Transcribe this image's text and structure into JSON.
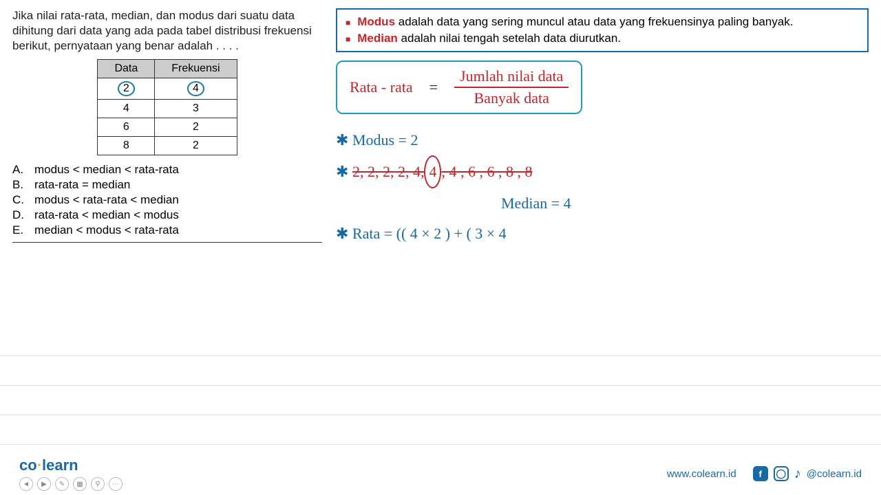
{
  "question": "Jika nilai rata-rata, median, dan modus dari suatu data dihitung dari data yang ada pada tabel distribusi frekuensi berikut, pernyataan yang benar adalah . . . .",
  "table": {
    "headers": [
      "Data",
      "Frekuensi"
    ],
    "rows": [
      {
        "data": "2",
        "freq": "4",
        "circled": true
      },
      {
        "data": "4",
        "freq": "3",
        "circled": false
      },
      {
        "data": "6",
        "freq": "2",
        "circled": false
      },
      {
        "data": "8",
        "freq": "2",
        "circled": false
      }
    ]
  },
  "options": [
    {
      "letter": "A.",
      "text": "modus < median < rata-rata"
    },
    {
      "letter": "B.",
      "text": "rata-rata = median"
    },
    {
      "letter": "C.",
      "text": "modus < rata-rata < median"
    },
    {
      "letter": "D.",
      "text": "rata-rata < median < modus"
    },
    {
      "letter": "E.",
      "text": "median < modus < rata-rata"
    }
  ],
  "info": {
    "modus_label": "Modus",
    "modus_text": " adalah data yang sering muncul atau data yang frekuensinya paling banyak.",
    "median_label": "Median",
    "median_text": " adalah nilai tengah setelah data diurutkan."
  },
  "formula": {
    "lhs": "Rata - rata",
    "eq": "=",
    "num": "Jumlah nilai data",
    "den": "Banyak data"
  },
  "work": {
    "modus_line": "✱  Modus  =  2",
    "list_prefix": "✱  ",
    "list_struck": "2, 2, 2, 2,  4,",
    "list_circled": "4",
    "list_struck2": ", 4 , 6 , 6 , 8 , 8",
    "median_line": "Median    =  4",
    "rata_line": "✱  Rata  =  (( 4 × 2 ) + ( 3 × 4"
  },
  "footer": {
    "logo_co": "co",
    "logo_learn": "learn",
    "url": "www.colearn.id",
    "handle": "@colearn.id"
  }
}
